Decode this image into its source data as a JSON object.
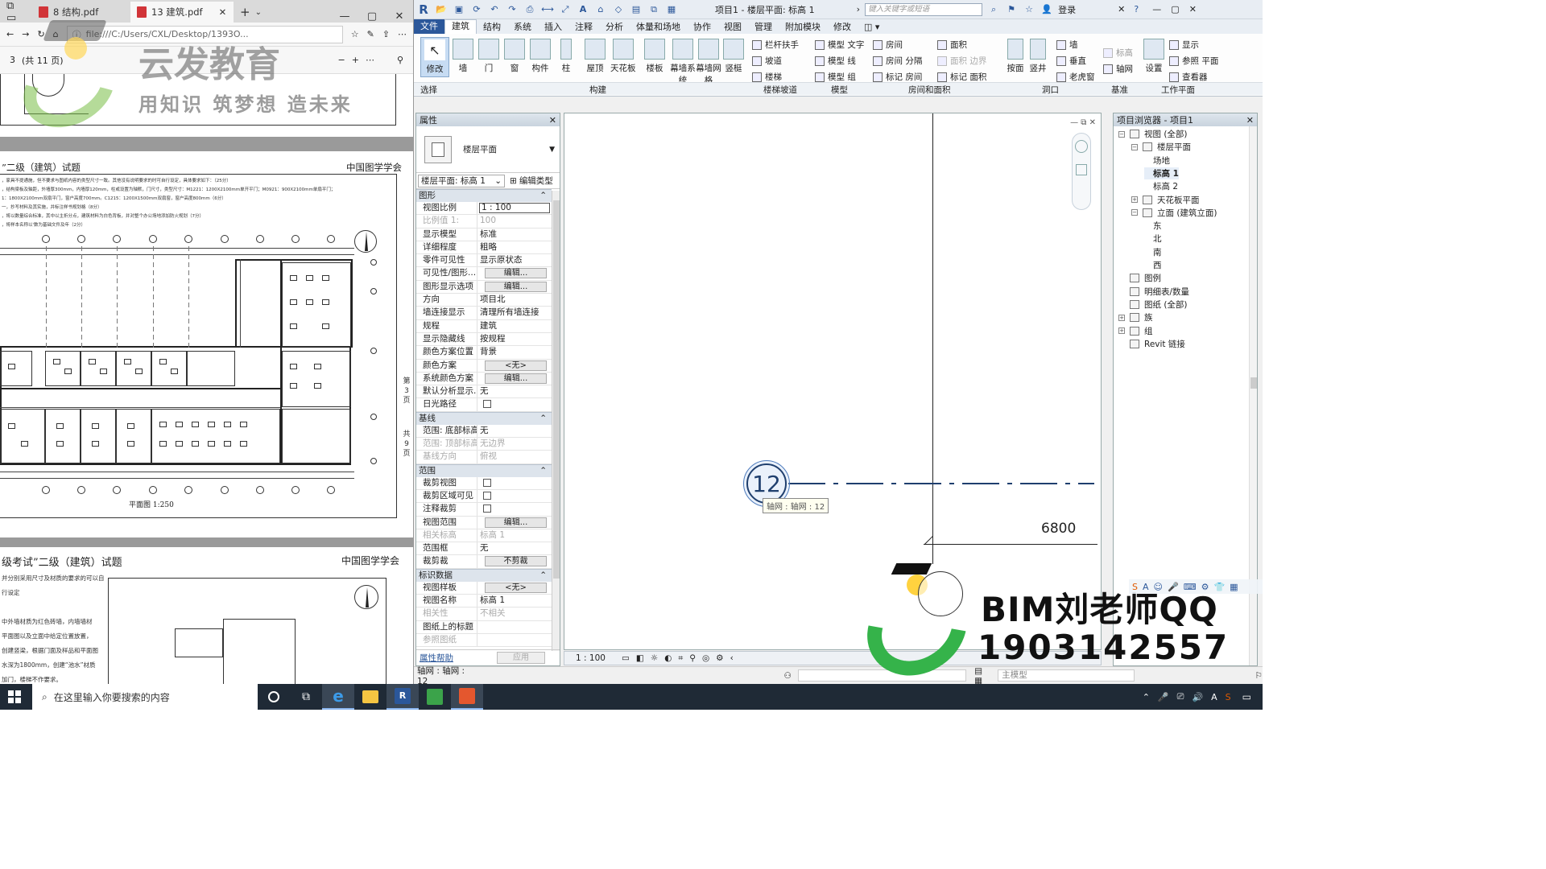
{
  "edge": {
    "tabs": [
      {
        "label": "8 结构.pdf",
        "active": false
      },
      {
        "label": "13 建筑.pdf",
        "active": true
      }
    ],
    "url": "file:///C:/Users/CXL/Desktop/1393O...",
    "page_current": "3",
    "page_total": "(共 11 页)",
    "sheet1_title": "”二级（建筑）试题",
    "sheet1_org": "中国图学学会",
    "sheet1_notes": [
      "，家具不提通施，但不要求与图纸内容的类型尺寸一致。其他没有说明要求的时可自行设定，具体要求如下：（25分）",
      "，结构梁板及轴距，外墙厚300mm，内墙厚120mm，柱或设置为轴默，门尺寸，类型尺寸：M1221：1200X2100mm单开平门；M0921：900X2100mm单扇平门；",
      "1：1800X2100mm双扇平门，窗户高度700mm。C1215：1200X1500mm双扇窗，窗户高度800mm（6分）",
      "一，抄写材料及其实施，并标注样书规划格（8分）",
      "，将以数量综合标准，其中以主折分点，建筑材料为白色背板，并对整个办公场地添加防火规划（7分）",
      "，将样本名称以'数为基础文件及年（2分）"
    ],
    "sheet1_side": [
      "第",
      "3",
      "页",
      "共",
      "9",
      "页"
    ],
    "sheet1_caption": "平面图 1:250",
    "sheet2_title": "级考试”二级（建筑）试题",
    "sheet2_org": "中国图学学会",
    "sheet2_notes": [
      "并分别采用尺寸及材质的要求的可以自行设定",
      "中外墙材质为红色砖墙，内墙墙材",
      "平面图以及立面中给定位置放置，",
      "创建竖梁，根据门面及样品和平面图",
      "水深为1800mm，创建“池水”材质",
      "加门，楼梯不作要求。"
    ],
    "watermark_brand": "云发教育",
    "watermark_slogan": "用知识 筑梦想 造未来"
  },
  "revit": {
    "title": "项目1 - 楼层平面: 标高 1",
    "search_placeholder": "键入关键字或短语",
    "login": "登录",
    "menu": [
      "文件",
      "建筑",
      "结构",
      "系统",
      "插入",
      "注释",
      "分析",
      "体量和场地",
      "协作",
      "视图",
      "管理",
      "附加模块",
      "修改"
    ],
    "menu_selected": "建筑",
    "ribbon": {
      "modify": "修改",
      "build_tools": [
        "墙",
        "门",
        "窗",
        "构件",
        "柱",
        "屋顶",
        "天花板",
        "楼板",
        "幕墙系统",
        "幕墙网格",
        "竖梃"
      ],
      "stair_tools": [
        "栏杆扶手",
        "坡道",
        "楼梯"
      ],
      "model_tools": [
        "模型 文字",
        "模型 线",
        "模型 组"
      ],
      "room_tools": [
        "房间",
        "房间 分隔",
        "标记 房间",
        "面积",
        "面积 边界",
        "标记 面积"
      ],
      "opening_tools": [
        "按面",
        "竖井",
        "墙",
        "垂直",
        "老虎窗"
      ],
      "datum_tools": [
        "标高",
        "轴网"
      ],
      "workplane_tools": [
        "设置",
        "显示",
        "参照 平面",
        "查看器"
      ],
      "groups": [
        "选择",
        "构建",
        "楼梯坡道",
        "模型",
        "房间和面积",
        "洞口",
        "基准",
        "工作平面"
      ]
    },
    "properties": {
      "title": "属性",
      "type_name": "楼层平面",
      "selector": "楼层平面: 标高 1",
      "edit_type": "编辑类型",
      "sections": [
        {
          "name": "图形",
          "rows": [
            {
              "k": "视图比例",
              "v": "1 : 100",
              "kind": "input"
            },
            {
              "k": "比例值 1:",
              "v": "100",
              "kind": "dis"
            },
            {
              "k": "显示模型",
              "v": "标准",
              "kind": "text"
            },
            {
              "k": "详细程度",
              "v": "粗略",
              "kind": "text"
            },
            {
              "k": "零件可见性",
              "v": "显示原状态",
              "kind": "text"
            },
            {
              "k": "可见性/图形...",
              "v": "编辑...",
              "kind": "btn"
            },
            {
              "k": "图形显示选项",
              "v": "编辑...",
              "kind": "btn"
            },
            {
              "k": "方向",
              "v": "项目北",
              "kind": "text"
            },
            {
              "k": "墙连接显示",
              "v": "清理所有墙连接",
              "kind": "text"
            },
            {
              "k": "规程",
              "v": "建筑",
              "kind": "text"
            },
            {
              "k": "显示隐藏线",
              "v": "按规程",
              "kind": "text"
            },
            {
              "k": "颜色方案位置",
              "v": "背景",
              "kind": "text"
            },
            {
              "k": "颜色方案",
              "v": "<无>",
              "kind": "btn"
            },
            {
              "k": "系统颜色方案",
              "v": "编辑...",
              "kind": "btn"
            },
            {
              "k": "默认分析显示...",
              "v": "无",
              "kind": "text"
            },
            {
              "k": "日光路径",
              "v": "",
              "kind": "chk"
            }
          ]
        },
        {
          "name": "基线",
          "rows": [
            {
              "k": "范围: 底部标高",
              "v": "无",
              "kind": "text"
            },
            {
              "k": "范围: 顶部标高",
              "v": "无边界",
              "kind": "dis"
            },
            {
              "k": "基线方向",
              "v": "俯视",
              "kind": "dis"
            }
          ]
        },
        {
          "name": "范围",
          "rows": [
            {
              "k": "裁剪视图",
              "v": "",
              "kind": "chk"
            },
            {
              "k": "裁剪区域可见",
              "v": "",
              "kind": "chk"
            },
            {
              "k": "注释裁剪",
              "v": "",
              "kind": "chk"
            },
            {
              "k": "视图范围",
              "v": "编辑...",
              "kind": "btn"
            },
            {
              "k": "相关标高",
              "v": "标高 1",
              "kind": "dis"
            },
            {
              "k": "范围框",
              "v": "无",
              "kind": "text"
            },
            {
              "k": "裁剪裁",
              "v": "不剪裁",
              "kind": "btn"
            }
          ]
        },
        {
          "name": "标识数据",
          "rows": [
            {
              "k": "视图样板",
              "v": "<无>",
              "kind": "btn"
            },
            {
              "k": "视图名称",
              "v": "标高 1",
              "kind": "text"
            },
            {
              "k": "相关性",
              "v": "不相关",
              "kind": "dis"
            },
            {
              "k": "图纸上的标题",
              "v": "",
              "kind": "text"
            },
            {
              "k": "参照图纸",
              "v": "",
              "kind": "dis"
            }
          ]
        }
      ],
      "help": "属性帮助",
      "apply": "应用"
    },
    "canvas": {
      "grid_bubble": "12",
      "tooltip": "轴网 : 轴网 : 12",
      "dimension": "6800",
      "scale": "1 : 100"
    },
    "browser": {
      "title": "项目浏览器 - 项目1",
      "items": [
        {
          "label": "视图 (全部)",
          "toggle": "−",
          "level": 0
        },
        {
          "label": "楼层平面",
          "toggle": "−",
          "level": 1
        },
        {
          "label": "场地",
          "toggle": "",
          "level": 2
        },
        {
          "label": "标高 1",
          "toggle": "",
          "level": 2,
          "bold": true
        },
        {
          "label": "标高 2",
          "toggle": "",
          "level": 2
        },
        {
          "label": "天花板平面",
          "toggle": "+",
          "level": 1
        },
        {
          "label": "立面 (建筑立面)",
          "toggle": "−",
          "level": 1
        },
        {
          "label": "东",
          "toggle": "",
          "level": 2
        },
        {
          "label": "北",
          "toggle": "",
          "level": 2
        },
        {
          "label": "南",
          "toggle": "",
          "level": 2
        },
        {
          "label": "西",
          "toggle": "",
          "level": 2
        },
        {
          "label": "图例",
          "toggle": "",
          "level": 0
        },
        {
          "label": "明细表/数量",
          "toggle": "",
          "level": 0
        },
        {
          "label": "图纸 (全部)",
          "toggle": "",
          "level": 0
        },
        {
          "label": "族",
          "toggle": "+",
          "level": 0
        },
        {
          "label": "组",
          "toggle": "+",
          "level": 0
        },
        {
          "label": "Revit 链接",
          "toggle": "",
          "level": 0
        }
      ]
    },
    "status_text": "轴网 : 轴网 : 12",
    "workset": "主模型",
    "bim_line1": "BIM刘老师QQ",
    "bim_line2": "1903142557"
  },
  "taskbar": {
    "search_placeholder": "在这里输入你要搜索的内容"
  },
  "colors": {
    "revit_blue": "#2b579a",
    "grid_line": "#1f3f6e",
    "taskbar": "#1f2a36",
    "pdf_red": "#d13438"
  }
}
